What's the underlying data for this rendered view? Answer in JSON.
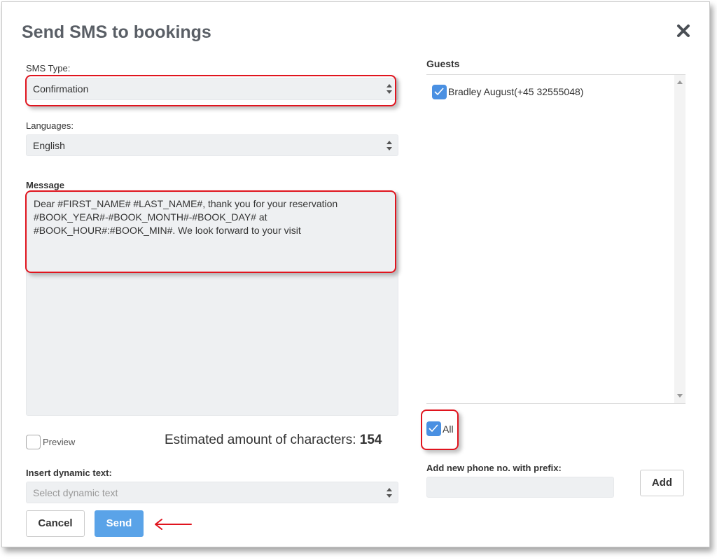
{
  "dialog": {
    "title": "Send SMS to bookings"
  },
  "sms_type": {
    "label": "SMS Type:",
    "value": "Confirmation"
  },
  "languages": {
    "label": "Languages:",
    "value": "English"
  },
  "message": {
    "label": "Message",
    "text": "Dear #FIRST_NAME# #LAST_NAME#, thank you for your reservation #BOOK_YEAR#-#BOOK_MONTH#-#BOOK_DAY# at #BOOK_HOUR#:#BOOK_MIN#. We look forward to your visit"
  },
  "preview": {
    "label": "Preview",
    "checked": false
  },
  "estimate": {
    "label": "Estimated amount of characters:",
    "count": "154"
  },
  "dynamic_text": {
    "label": "Insert dynamic text:",
    "placeholder": "Select dynamic text"
  },
  "buttons": {
    "cancel": "Cancel",
    "send": "Send",
    "add": "Add"
  },
  "guests": {
    "label": "Guests",
    "items": [
      {
        "name": "Bradley August(+45 32555048)",
        "checked": true
      }
    ],
    "all_label": "All",
    "all_checked": true
  },
  "new_phone": {
    "label": "Add new phone no. with prefix:",
    "value": ""
  },
  "colors": {
    "accent": "#5aa3e8",
    "highlight": "#e0141e",
    "checkbox": "#4a90e2"
  }
}
